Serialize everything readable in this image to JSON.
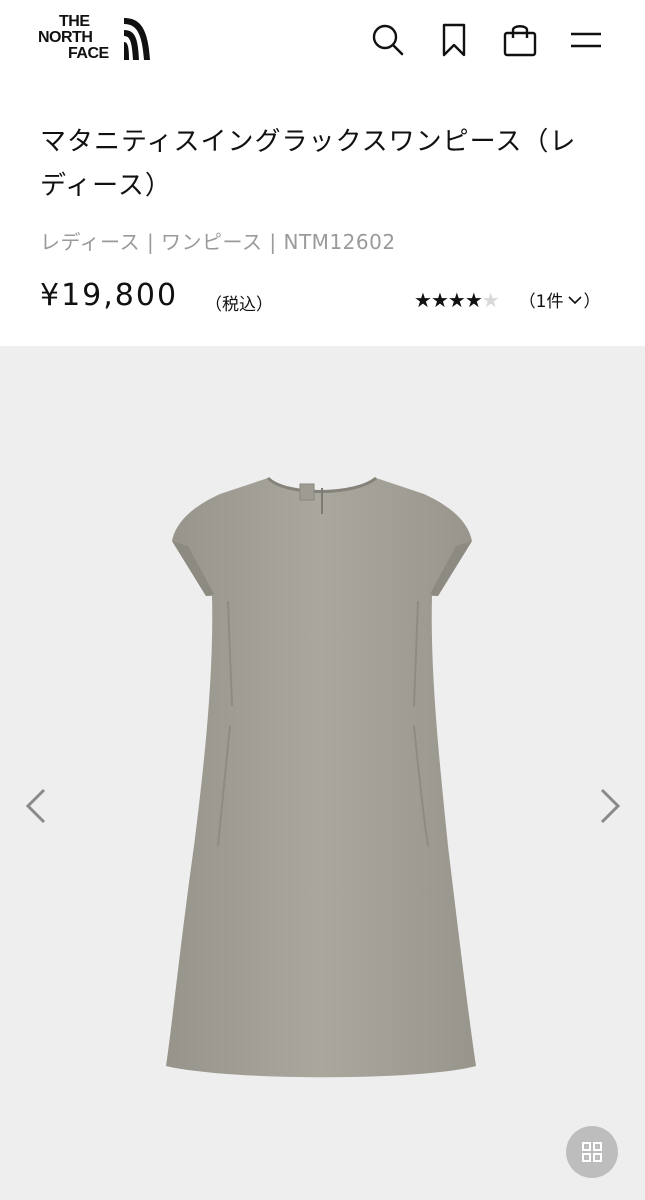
{
  "brand": {
    "logo_lines": [
      "THE",
      "NORTH",
      "FACE"
    ]
  },
  "header": {
    "icons": [
      "search-icon",
      "bookmark-icon",
      "shopping-bag-icon",
      "menu-icon"
    ]
  },
  "product": {
    "title": "マタニティスイングラックスワンピース（レディース）",
    "meta": "レディース | ワンピース | NTM12602",
    "price": "¥19,800",
    "tax_label": "（税込）",
    "rating": {
      "value": 4,
      "max": 5
    },
    "review_count": "（1件",
    "review_suffix": "）"
  },
  "gallery": {
    "product_color": "#a3a097",
    "background_color": "#eeeeee",
    "icons": [
      "chevron-left-icon",
      "chevron-right-icon",
      "grid-icon"
    ]
  }
}
